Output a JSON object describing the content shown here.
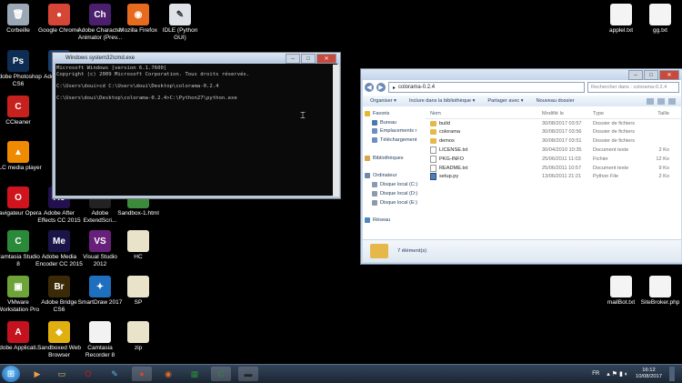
{
  "desktop_icons": [
    {
      "id": "corbeille",
      "label": "Corbeille",
      "icon": "recycle-bin-icon",
      "color": "#9aa7b5",
      "glyph": "🗑"
    },
    {
      "id": "chrome",
      "label": "Google Chrome",
      "icon": "chrome-icon",
      "color": "#d54637",
      "glyph": "●"
    },
    {
      "id": "character-animator",
      "label": "Adobe Character Animator (Prev...",
      "icon": "adobe-character-animator-icon",
      "color": "#4b1f6e",
      "glyph": "Ch"
    },
    {
      "id": "firefox",
      "label": "Mozilla Firefox",
      "icon": "firefox-icon",
      "color": "#e66b1e",
      "glyph": "◉"
    },
    {
      "id": "idle",
      "label": "IDLE (Python GUI)",
      "icon": "python-idle-icon",
      "color": "#dfe3e8",
      "glyph": "✎"
    },
    {
      "id": "photoshop",
      "label": "Adobe Photoshop CS6",
      "icon": "photoshop-icon",
      "color": "#0d2d52",
      "glyph": "Ps"
    },
    {
      "id": "ccleaner",
      "label": "CCleaner",
      "icon": "ccleaner-icon",
      "color": "#c7211d",
      "glyph": "C"
    },
    {
      "id": "adobe-partial",
      "label": "Adob Photo",
      "icon": "adobe-partial-icon",
      "color": "#1a3e6b",
      "glyph": ""
    },
    {
      "id": "vlc",
      "label": "VLC media player",
      "icon": "vlc-icon",
      "color": "#f08a00",
      "glyph": "▲"
    },
    {
      "id": "opera",
      "label": "Navigateur Opera",
      "icon": "opera-icon",
      "color": "#d0141e",
      "glyph": "O"
    },
    {
      "id": "after-effects",
      "label": "Adobe After Effects CC 2015",
      "icon": "after-effects-icon",
      "color": "#23104f",
      "glyph": "Ae"
    },
    {
      "id": "extendscript",
      "label": "Adobe ExtendScri...",
      "icon": "extendscript-icon",
      "color": "#222",
      "glyph": ""
    },
    {
      "id": "sandbox-html",
      "label": "Sandbox-1.html",
      "icon": "html-file-icon",
      "color": "#3c8a3c",
      "glyph": ""
    },
    {
      "id": "camtasia",
      "label": "Camtasia Studio 8",
      "icon": "camtasia-icon",
      "color": "#2a8a3a",
      "glyph": "C"
    },
    {
      "id": "media-encoder",
      "label": "Adobe Media Encoder CC 2015",
      "icon": "media-encoder-icon",
      "color": "#1b1449",
      "glyph": "Me"
    },
    {
      "id": "visual-studio",
      "label": "Visual Studio 2012",
      "icon": "visual-studio-icon",
      "color": "#68217a",
      "glyph": "VS"
    },
    {
      "id": "hc",
      "label": "HC",
      "icon": "file-icon",
      "color": "#e9e3c9",
      "glyph": ""
    },
    {
      "id": "vmware",
      "label": "VMware Workstation Pro",
      "icon": "vmware-icon",
      "color": "#6ea33a",
      "glyph": "▣"
    },
    {
      "id": "bridge",
      "label": "Adobe Bridge CS6",
      "icon": "adobe-bridge-icon",
      "color": "#3a2a08",
      "glyph": "Br"
    },
    {
      "id": "smartdraw",
      "label": "SmartDraw 2017",
      "icon": "smartdraw-icon",
      "color": "#1f6fbf",
      "glyph": "✦"
    },
    {
      "id": "sp",
      "label": "SP",
      "icon": "file-icon",
      "color": "#e9e3c9",
      "glyph": ""
    },
    {
      "id": "adobe-applic",
      "label": "Adobe Applicati...",
      "icon": "adobe-application-manager-icon",
      "color": "#c4121e",
      "glyph": "A"
    },
    {
      "id": "sandboxed-web",
      "label": "Sandboxed Web Browser",
      "icon": "sandboxed-browser-icon",
      "color": "#e0b010",
      "glyph": "◆"
    },
    {
      "id": "camtasia-recorder",
      "label": "Camtasia Recorder 8",
      "icon": "camtasia-recorder-icon",
      "color": "#f2f2f2",
      "glyph": ""
    },
    {
      "id": "zip",
      "label": "zip",
      "icon": "zip-file-icon",
      "color": "#e9e3c9",
      "glyph": ""
    },
    {
      "id": "applel",
      "label": "applel.txt",
      "icon": "text-file-icon",
      "color": "#f4f4f4",
      "glyph": ""
    },
    {
      "id": "gg",
      "label": "gg.txt",
      "icon": "text-file-icon",
      "color": "#f4f4f4",
      "glyph": ""
    },
    {
      "id": "mailbot",
      "label": "mailBot.txt",
      "icon": "text-file-icon",
      "color": "#f4f4f4",
      "glyph": ""
    },
    {
      "id": "sitebroker",
      "label": "SiteBroker.php",
      "icon": "php-file-icon",
      "color": "#f4f4f4",
      "glyph": ""
    }
  ],
  "console": {
    "title": "Windows system32\\cmd.exe",
    "lines": [
      "Microsoft Windows [version 6.1.7600]",
      "Copyright (c) 2009 Microsoft Corporation. Tous droits réservés.",
      "",
      "C:\\Users\\doui>cd C:\\Users\\doui\\Desktop\\colorama-0.2.4",
      "",
      "C:\\Users\\doui\\Desktop\\colorama-0.2.4>C:\\Python27\\python.exe"
    ]
  },
  "explorer": {
    "address": "colorama-0.2.4",
    "search_placeholder": "Rechercher dans : colorama-0.2.4",
    "toolbar": [
      "Organiser ▾",
      "Inclure dans la bibliothèque ▾",
      "Partager avec ▾",
      "Nouveau dossier"
    ],
    "nav": [
      {
        "label": "Favoris",
        "icon": "star-icon",
        "color": "#e8b92f"
      },
      {
        "label": "Bureau",
        "icon": "desktop-icon",
        "color": "#4a78b0"
      },
      {
        "label": "Emplacements r",
        "icon": "recent-places-icon",
        "color": "#6a8fc0"
      },
      {
        "label": "Téléchargement",
        "icon": "downloads-icon",
        "color": "#6a8fc0"
      },
      {
        "label": "",
        "icon": "",
        "color": ""
      },
      {
        "label": "Bibliothèques",
        "icon": "libraries-icon",
        "color": "#d9a74a"
      },
      {
        "label": "",
        "icon": "",
        "color": ""
      },
      {
        "label": "Ordinateur",
        "icon": "computer-icon",
        "color": "#6f8aa6"
      },
      {
        "label": "Disque local (C:)",
        "icon": "drive-icon",
        "color": "#8b9aad"
      },
      {
        "label": "Disque local (D:)",
        "icon": "drive-icon",
        "color": "#8b9aad"
      },
      {
        "label": "Disque local (E:)",
        "icon": "drive-icon",
        "color": "#8b9aad"
      },
      {
        "label": "",
        "icon": "",
        "color": ""
      },
      {
        "label": "Réseau",
        "icon": "network-icon",
        "color": "#4f87c0"
      }
    ],
    "columns": [
      "Nom",
      "Modifié le",
      "Type",
      "Taille"
    ],
    "files": [
      {
        "name": "build",
        "modified": "30/08/2017 03:57",
        "type": "Dossier de fichiers",
        "size": "",
        "kind": "folder"
      },
      {
        "name": "colorama",
        "modified": "30/08/2017 03:56",
        "type": "Dossier de fichiers",
        "size": "",
        "kind": "folder"
      },
      {
        "name": "demos",
        "modified": "30/08/2017 03:51",
        "type": "Dossier de fichiers",
        "size": "",
        "kind": "folder"
      },
      {
        "name": "LICENSE.txt",
        "modified": "30/04/2010 10:35",
        "type": "Document texte",
        "size": "2 Ko",
        "kind": "doc"
      },
      {
        "name": "PKG-INFO",
        "modified": "25/06/2011 11:03",
        "type": "Fichier",
        "size": "12 Ko",
        "kind": "doc"
      },
      {
        "name": "README.txt",
        "modified": "25/06/2011 10:57",
        "type": "Document texte",
        "size": "9 Ko",
        "kind": "doc"
      },
      {
        "name": "setup.py",
        "modified": "13/06/2011 21:21",
        "type": "Python File",
        "size": "2 Ko",
        "kind": "py"
      }
    ],
    "status": "7 élément(s)"
  },
  "taskbar": {
    "buttons": [
      {
        "id": "media",
        "icon": "media-player-icon",
        "color": "#f0a040",
        "glyph": "▶"
      },
      {
        "id": "explorer",
        "icon": "file-explorer-icon",
        "color": "#e2c46a",
        "glyph": "▭"
      },
      {
        "id": "opera",
        "icon": "opera-icon",
        "color": "#d0141e",
        "glyph": "O"
      },
      {
        "id": "notes",
        "icon": "notes-icon",
        "color": "#6ab0e0",
        "glyph": "✎"
      },
      {
        "id": "chrome",
        "icon": "chrome-icon",
        "color": "#d54637",
        "glyph": "●"
      },
      {
        "id": "firefox",
        "icon": "firefox-icon",
        "color": "#e66b1e",
        "glyph": "◉"
      },
      {
        "id": "excel",
        "icon": "spreadsheet-icon",
        "color": "#2a8a3a",
        "glyph": "▦"
      },
      {
        "id": "camtasia",
        "icon": "camtasia-icon",
        "color": "#2a8a3a",
        "glyph": "C"
      },
      {
        "id": "cmd",
        "icon": "command-prompt-icon",
        "color": "#222",
        "glyph": "▬"
      }
    ],
    "language": "FR",
    "time": "16:12",
    "date": "10/08/2017"
  }
}
